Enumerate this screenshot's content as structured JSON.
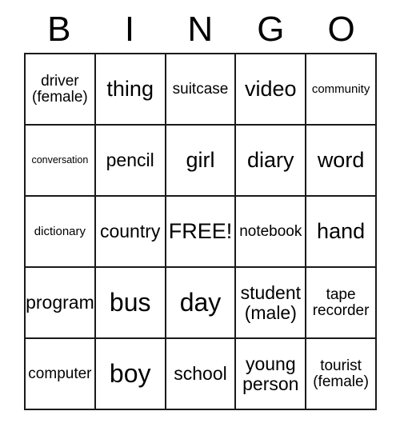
{
  "card": {
    "title_letters": [
      "B",
      "I",
      "N",
      "G",
      "O"
    ],
    "free_space_label": "FREE!",
    "border_color": "#1a1a1a",
    "text_color": "#000000",
    "background_color": "#ffffff",
    "columns": 5,
    "rows": 5,
    "cells": [
      [
        {
          "text": "driver\n(female)"
        },
        {
          "text": "thing"
        },
        {
          "text": "suitcase"
        },
        {
          "text": "video"
        },
        {
          "text": "community"
        }
      ],
      [
        {
          "text": "conversation"
        },
        {
          "text": "pencil"
        },
        {
          "text": "girl"
        },
        {
          "text": "diary"
        },
        {
          "text": "word"
        }
      ],
      [
        {
          "text": "dictionary"
        },
        {
          "text": "country"
        },
        {
          "text": "FREE!"
        },
        {
          "text": "notebook"
        },
        {
          "text": "hand"
        }
      ],
      [
        {
          "text": "program"
        },
        {
          "text": "bus"
        },
        {
          "text": "day"
        },
        {
          "text": "student\n(male)"
        },
        {
          "text": "tape\nrecorder"
        }
      ],
      [
        {
          "text": "computer"
        },
        {
          "text": "boy"
        },
        {
          "text": "school"
        },
        {
          "text": "young\nperson"
        },
        {
          "text": "tourist\n(female)"
        }
      ]
    ]
  }
}
